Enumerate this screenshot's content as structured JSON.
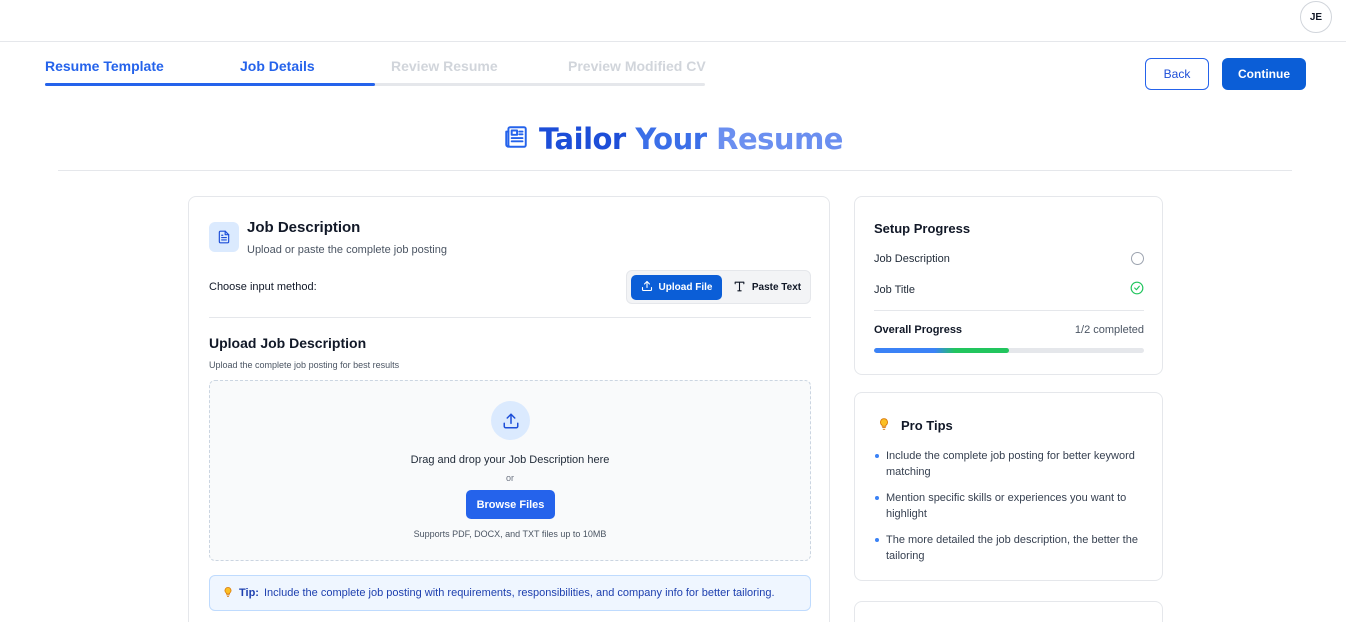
{
  "user": {
    "initials": "JE"
  },
  "stepper": {
    "steps": [
      {
        "label": "Resume Template",
        "state": "done"
      },
      {
        "label": "Job Details",
        "state": "active"
      },
      {
        "label": "Review Resume",
        "state": "upcoming"
      },
      {
        "label": "Preview Modified CV",
        "state": "upcoming"
      }
    ],
    "progress_fraction": 0.5
  },
  "nav": {
    "back_label": "Back",
    "continue_label": "Continue"
  },
  "page": {
    "title_part1": "Tailor",
    "title_part2": "Your",
    "title_part3": "Resume"
  },
  "job_description": {
    "title": "Job Description",
    "subtitle": "Upload or paste the complete job posting",
    "choose_label": "Choose input method:",
    "upload_option": "Upload File",
    "paste_option": "Paste Text",
    "selected_option": "Upload File",
    "upload_title": "Upload Job Description",
    "upload_subtitle": "Upload the complete job posting for best results",
    "drop_text": "Drag and drop your Job Description here",
    "or_text": "or",
    "browse_label": "Browse Files",
    "supports_text": "Supports PDF, DOCX, and TXT files up to 10MB",
    "tip_label": "Tip:",
    "tip_text": "Include the complete job posting with requirements, responsibilities, and company info for better tailoring."
  },
  "setup_progress": {
    "title": "Setup Progress",
    "items": [
      {
        "label": "Job Description",
        "status": "pending"
      },
      {
        "label": "Job Title",
        "status": "complete"
      }
    ],
    "overall_label": "Overall Progress",
    "overall_value": "1/2 completed",
    "fraction": 0.5
  },
  "pro_tips": {
    "title": "Pro Tips",
    "items": [
      "Include the complete job posting for better keyword matching",
      "Mention specific skills or experiences you want to highlight",
      "The more detailed the job description, the better the tailoring"
    ]
  },
  "colors": {
    "primary": "#2563eb",
    "primary_dark": "#0b5ed7",
    "success": "#22c55e",
    "inactive_step": "#d1d5db"
  },
  "icons": {
    "title_icon": "newspaper-icon",
    "job_icon": "document-icon",
    "upload_icon": "upload-icon",
    "paste_icon": "text-icon",
    "tip_icon": "lightbulb-icon",
    "check_icon": "check-circle-icon"
  }
}
